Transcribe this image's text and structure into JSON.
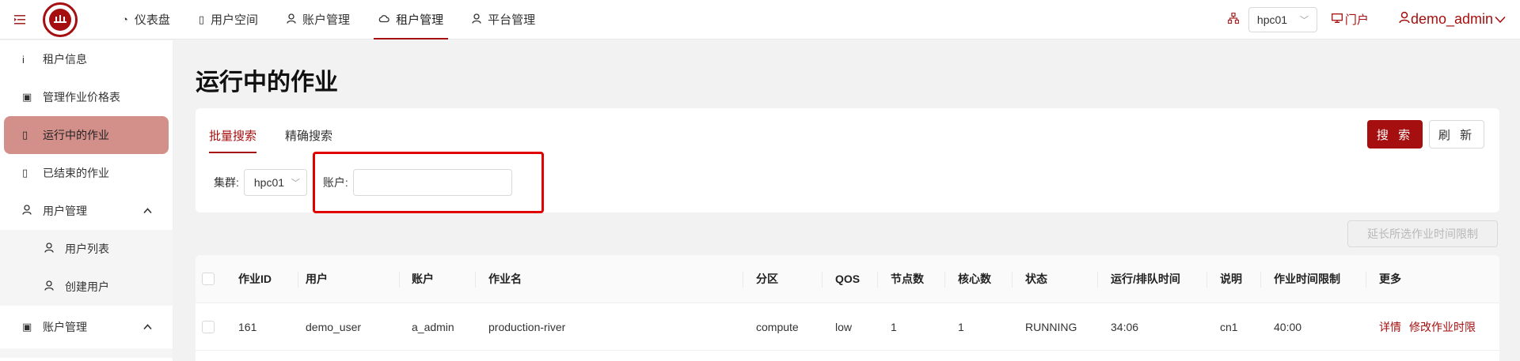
{
  "topbar": {
    "nav": [
      {
        "label": "仪表盘",
        "icon": "dashboard-icon"
      },
      {
        "label": "用户空间",
        "icon": "document-icon"
      },
      {
        "label": "账户管理",
        "icon": "user-icon"
      },
      {
        "label": "租户管理",
        "icon": "cloud-icon",
        "active": true
      },
      {
        "label": "平台管理",
        "icon": "user-icon"
      }
    ],
    "cluster": "hpc01",
    "portal": "门户",
    "user": "demo_admin"
  },
  "sidebar": {
    "items": [
      {
        "label": "租户信息",
        "icon": "info-icon"
      },
      {
        "label": "管理作业价格表",
        "icon": "price-icon"
      },
      {
        "label": "运行中的作业",
        "icon": "book-icon",
        "active": true
      },
      {
        "label": "已结束的作业",
        "icon": "book-icon"
      },
      {
        "label": "用户管理",
        "icon": "user-icon",
        "group": true
      },
      {
        "label": "用户列表",
        "icon": "user-icon",
        "sub": true
      },
      {
        "label": "创建用户",
        "icon": "user-icon",
        "sub": true
      },
      {
        "label": "账户管理",
        "icon": "account-icon",
        "group": true
      }
    ]
  },
  "main": {
    "title": "运行中的作业",
    "tabs": [
      "批量搜索",
      "精确搜索"
    ],
    "search_label": "搜 索",
    "refresh_label": "刷 新",
    "cluster_label": "集群:",
    "cluster_value": "hpc01",
    "account_label": "账户:",
    "account_value": "",
    "extend_label": "延长所选作业时间限制"
  },
  "table": {
    "columns": [
      "作业ID",
      "用户",
      "账户",
      "作业名",
      "分区",
      "QOS",
      "节点数",
      "核心数",
      "状态",
      "运行/排队时间",
      "说明",
      "作业时间限制",
      "更多"
    ],
    "rows": [
      {
        "cells": [
          "161",
          "demo_user",
          "a_admin",
          "production-river",
          "compute",
          "low",
          "1",
          "1",
          "RUNNING",
          "34:06",
          "cn1",
          "40:00"
        ],
        "actions": [
          "详情",
          "修改作业时限"
        ]
      }
    ]
  },
  "colors": {
    "brand": "#a50f0f",
    "active_side": "#d38f8a",
    "highlight": "#e00000"
  }
}
